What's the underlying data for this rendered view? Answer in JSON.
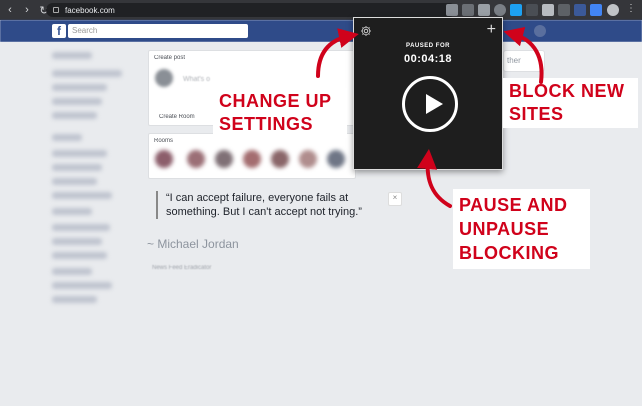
{
  "browser": {
    "url": "facebook.com",
    "nav": {
      "back": "‹",
      "forward": "›",
      "reload": "↻",
      "home": "⌂"
    }
  },
  "facebook": {
    "search_placeholder": "Search",
    "logo": "f",
    "create_post_label": "Create post",
    "create_post_prompt": "What's o",
    "create_room": "Create Room",
    "rooms_label": "Rooms",
    "side_label": "ther",
    "quote": {
      "text": "“I can accept failure, everyone fails at something. But I can't accept not trying.”",
      "author": "~ Michael Jordan",
      "footer": "News Feed Eradicator"
    }
  },
  "extension_popup": {
    "status_label": "PAUSED FOR",
    "timer": "00:04:18",
    "icons": [
      "gear-icon",
      "plus-icon",
      "play-icon"
    ]
  },
  "annotations": {
    "settings": "CHANGE UP SETTINGS",
    "block": "BLOCK NEW SITES",
    "pause": "PAUSE AND UNPAUSE BLOCKING",
    "color": "#d0021b"
  }
}
